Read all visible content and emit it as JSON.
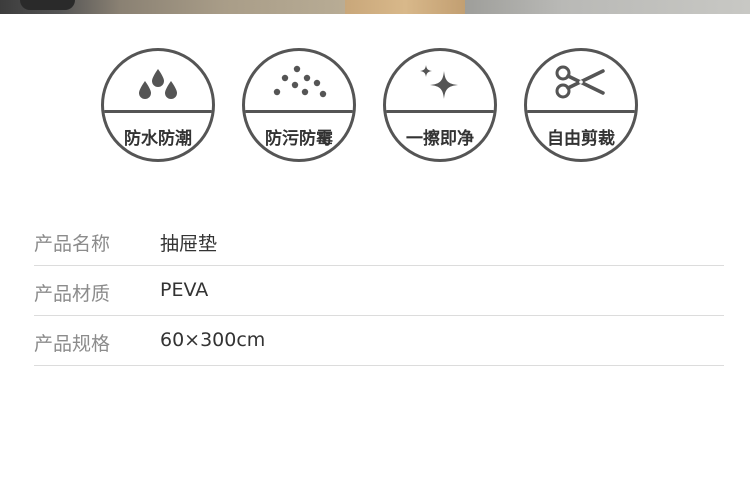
{
  "features": [
    {
      "label": "防水防潮",
      "icon": "water-drops-icon"
    },
    {
      "label": "防污防霉",
      "icon": "dots-icon"
    },
    {
      "label": "一擦即净",
      "icon": "sparkle-icon"
    },
    {
      "label": "自由剪裁",
      "icon": "scissors-icon"
    }
  ],
  "specs": [
    {
      "key": "产品名称",
      "value": "抽屉垫"
    },
    {
      "key": "产品材质",
      "value": "PEVA"
    },
    {
      "key": "产品规格",
      "value": "60×300cm"
    }
  ],
  "colors": {
    "icon_stroke": "#555555",
    "label_text": "#333333",
    "key_text": "#8c8c8c",
    "divider": "#dcdcdc"
  }
}
